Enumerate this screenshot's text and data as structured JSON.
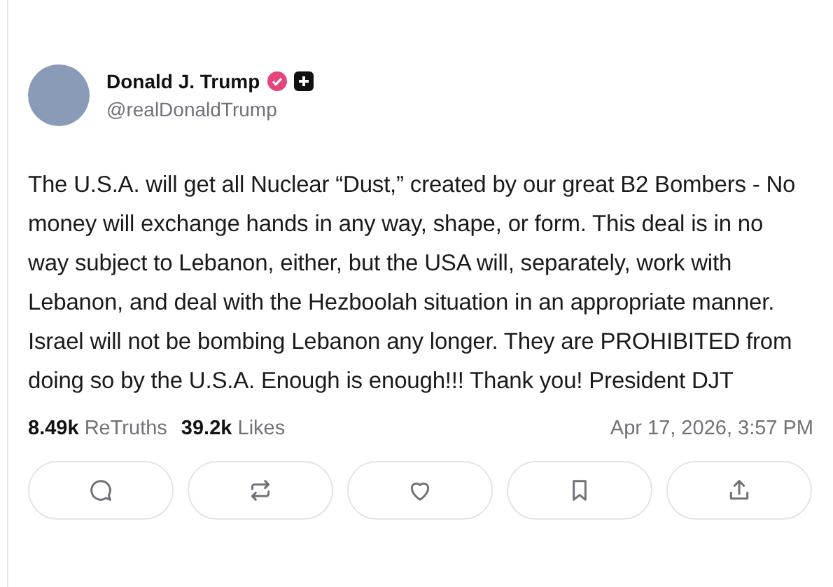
{
  "author": {
    "name": "Donald J. Trump",
    "handle": "@realDonaldTrump",
    "verified": true
  },
  "text": "The U.S.A. will get all Nuclear “Dust,” created by our great B2 Bombers - No money will exchange hands in any way, shape, or form. This deal is in no way subject to Lebanon, either, but the USA will, separately, work with Lebanon, and deal with the Hezboolah situation in an appropriate manner. Israel will not be bombing Lebanon any longer. They are PROHIBITED from doing so by the U.S.A. Enough is enough!!! Thank you! President DJT",
  "stats": [
    {
      "count": "8.49k",
      "label": "ReTruths"
    },
    {
      "count": "39.2k",
      "label": "Likes"
    }
  ],
  "timestamp": "Apr 17, 2026, 3:57 PM",
  "actions": [
    {
      "kind": "reply"
    },
    {
      "kind": "retruth"
    },
    {
      "kind": "like"
    },
    {
      "kind": "bookmark"
    },
    {
      "kind": "share"
    }
  ]
}
